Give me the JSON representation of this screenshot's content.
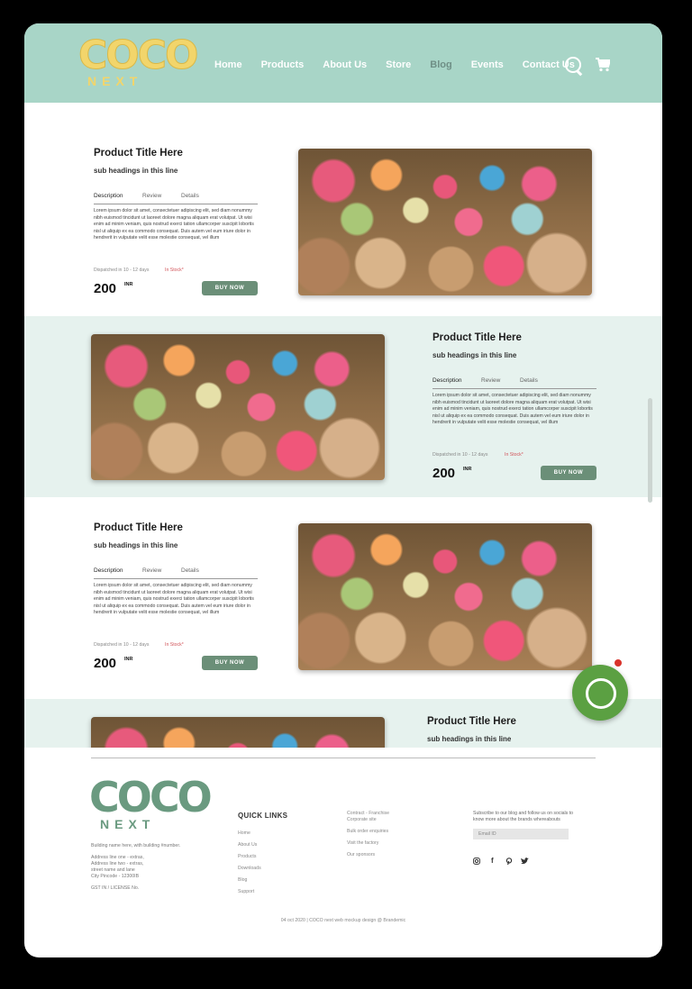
{
  "brand": {
    "logo_top": "COCO",
    "logo_bottom": "NEXT"
  },
  "nav": {
    "items": [
      {
        "label": "Home"
      },
      {
        "label": "Products"
      },
      {
        "label": "About Us"
      },
      {
        "label": "Store"
      },
      {
        "label": "Blog"
      },
      {
        "label": "Events"
      },
      {
        "label": "Contact Us"
      }
    ],
    "active": "Blog",
    "icons": [
      "search-icon",
      "cart-icon"
    ]
  },
  "product_card": {
    "title": "Product Title Here",
    "subtitle": "sub headings in this line",
    "tabs": [
      "Description",
      "Review",
      "Details"
    ],
    "description": "Lorem ipsum dolor sit amet, consectetuer adipiscing elit, sed diam nonummy nibh euismod tincidunt ut laoreet dolore magna aliquam erat volutpat. Ut wisi enim ad minim veniam, quis nostrud exerci tation ullamcorper suscipit lobortis nisl ut aliquip ex ea commodo consequat. Duis autem vel eum iriure dolor in hendrerit in vulputate velit esse molestie consequat, vel illum",
    "dispatch": "Dispatched in 10 - 12 days",
    "stock": "In Stock*",
    "price": "200",
    "currency": "INR",
    "buy_label": "BUY NOW"
  },
  "footer": {
    "logo_top": "COCO",
    "logo_bottom": "NEXT",
    "address_line1": "Building name here, with building #number.",
    "address_line2": "Address line one - extras,",
    "address_line3": "Address line two - extras,",
    "address_line4": "street name and lane",
    "address_line5": "City Pincode - 12300IB",
    "license": "GST IN / LICENSE No.",
    "quick_links_title": "QUICK LINKS",
    "quick_links": [
      "Home",
      "About Us",
      "Products",
      "Downloads",
      "Blog",
      "Support"
    ],
    "more_links": [
      "Contract - Franchise Corporate site",
      "Bulk order enquiries",
      "Visit the factory",
      "Our sponsors"
    ],
    "subscribe_text": "Subscribe to our blog and follow us on socials to know more about the brands whereabouts",
    "email_placeholder": "Email ID",
    "social_icons": [
      "instagram-icon",
      "facebook-icon",
      "pinterest-icon",
      "twitter-icon"
    ],
    "copyright": "04 oct 2020 | COCO next web mockup design @ Brandemic"
  },
  "colors": {
    "header": "#a8d5c7",
    "band": "#e6f2ee",
    "button": "#6b8f78",
    "logo": "#f2d56b",
    "footer_logo": "#6a9a80",
    "stock": "#d2555b"
  }
}
